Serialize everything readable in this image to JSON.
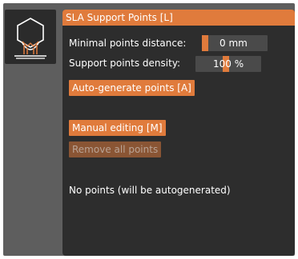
{
  "panel": {
    "title": "SLA Support Points [L]",
    "min_distance": {
      "label": "Minimal points distance:",
      "value": "0 mm",
      "slider_fraction": 0.0
    },
    "density": {
      "label": "Support points density:",
      "value": "100 %",
      "slider_fraction": 0.2
    },
    "auto_generate_label": "Auto-generate points [A]",
    "manual_editing_label": "Manual editing [M]",
    "remove_all_label": "Remove all points",
    "status_text": "No points  (will be autogenerated)"
  },
  "tool_icon": "sla-support-points-icon",
  "colors": {
    "accent": "#e07b3c",
    "panel_bg": "#2d2d2d",
    "disabled_button": "#8a5534"
  }
}
